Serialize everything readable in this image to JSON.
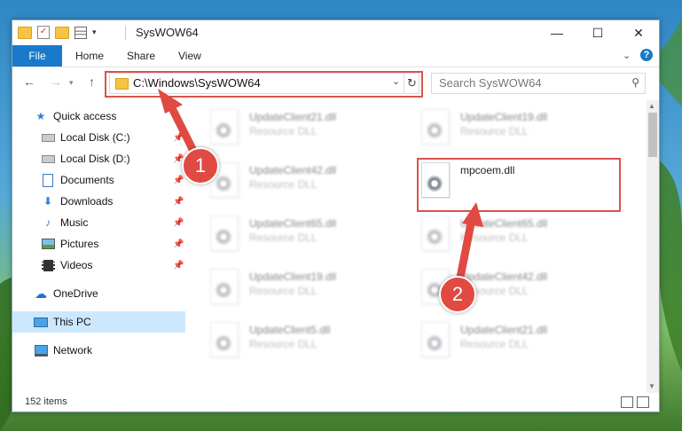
{
  "window": {
    "title": "SysWOW64",
    "controls": {
      "minimize": "—",
      "maximize": "☐",
      "close": "✕"
    }
  },
  "ribbon": {
    "file": "File",
    "home": "Home",
    "share": "Share",
    "view": "View",
    "help": "?"
  },
  "nav": {
    "address": "C:\\Windows\\SysWOW64",
    "search_placeholder": "Search SysWOW64"
  },
  "sidebar": {
    "items": [
      {
        "label": "Quick access",
        "icon": "star-icon"
      },
      {
        "label": "Local Disk (C:)",
        "icon": "drive-icon",
        "pinned": true
      },
      {
        "label": "Local Disk (D:)",
        "icon": "drive-icon",
        "pinned": true
      },
      {
        "label": "Documents",
        "icon": "document-icon",
        "pinned": true
      },
      {
        "label": "Downloads",
        "icon": "download-icon",
        "pinned": true
      },
      {
        "label": "Music",
        "icon": "music-icon",
        "pinned": true
      },
      {
        "label": "Pictures",
        "icon": "picture-icon",
        "pinned": true
      },
      {
        "label": "Videos",
        "icon": "video-icon",
        "pinned": true
      },
      {
        "label": "OneDrive",
        "icon": "cloud-icon"
      },
      {
        "label": "This PC",
        "icon": "computer-icon",
        "selected": true
      },
      {
        "label": "Network",
        "icon": "network-icon"
      }
    ]
  },
  "files": [
    {
      "name": "UpdateClient21.dll",
      "type": "Resource DLL"
    },
    {
      "name": "UpdateClient19.dll",
      "type": "Resource DLL"
    },
    {
      "name": "UpdateClient42.dll",
      "type": "Resource DLL"
    },
    {
      "name": "mpcoem.dll",
      "type": ""
    },
    {
      "name": "UpdateClient65.dll",
      "type": "Resource DLL"
    },
    {
      "name": "UpdateClient65.dll",
      "type": "Resource DLL"
    },
    {
      "name": "UpdateClient19.dll",
      "type": "Resource DLL"
    },
    {
      "name": "UpdateClient42.dll",
      "type": "Resource DLL"
    },
    {
      "name": "UpdateClient5.dll",
      "type": "Resource DLL"
    },
    {
      "name": "UpdateClient21.dll",
      "type": "Resource DLL"
    }
  ],
  "status": {
    "count": "152 items"
  },
  "annotations": {
    "marker1": "1",
    "marker2": "2",
    "color": "#e04a42"
  }
}
